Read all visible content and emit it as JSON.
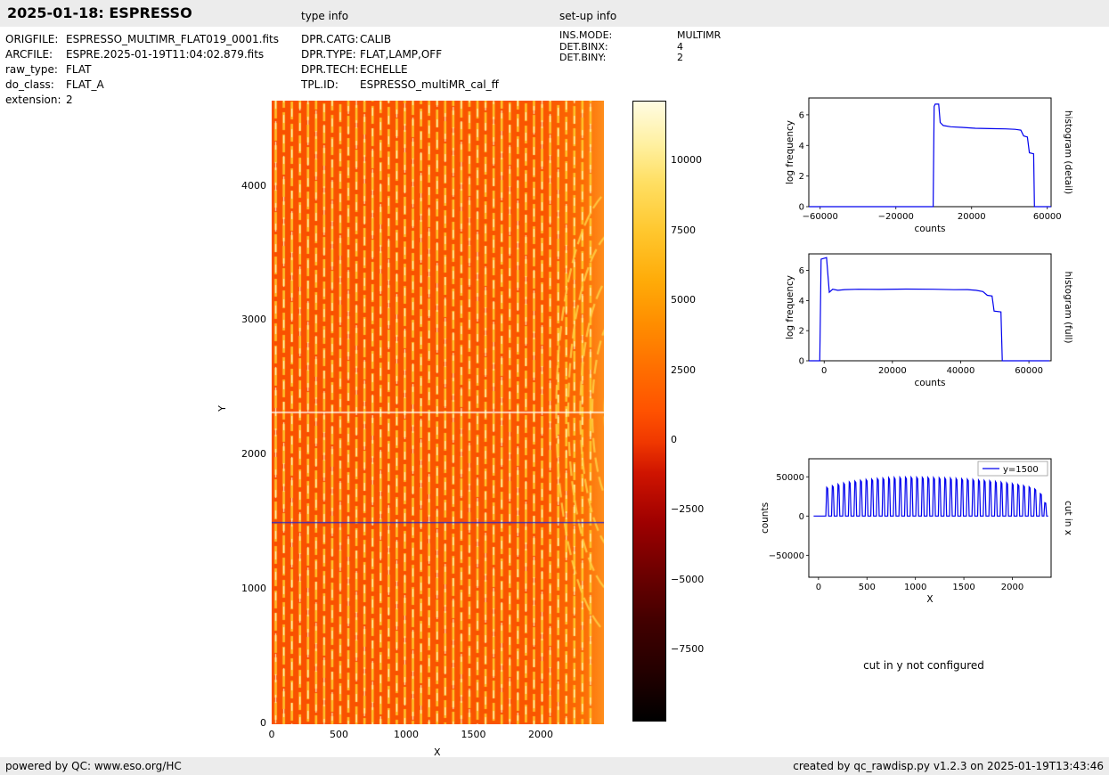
{
  "header": {
    "title": "2025-01-18: ESPRESSO",
    "type_info_label": "type info",
    "setup_info_label": "set-up info"
  },
  "metadata": {
    "file_info": [
      {
        "label": "ORIGFILE:",
        "value": "ESPRESSO_MULTIMR_FLAT019_0001.fits"
      },
      {
        "label": "ARCFILE:",
        "value": "ESPRE.2025-01-19T11:04:02.879.fits"
      },
      {
        "label": "raw_type:",
        "value": "FLAT"
      },
      {
        "label": "do_class:",
        "value": "FLAT_A"
      },
      {
        "label": "extension:",
        "value": "2"
      }
    ],
    "type_info": [
      {
        "label": "DPR.CATG:",
        "value": "CALIB"
      },
      {
        "label": "DPR.TYPE:",
        "value": "FLAT,LAMP,OFF"
      },
      {
        "label": "DPR.TECH:",
        "value": "ECHELLE"
      },
      {
        "label": "TPL.ID:",
        "value": "ESPRESSO_multiMR_cal_ff"
      }
    ],
    "setup_info": [
      {
        "label": "INS.MODE:",
        "value": "MULTIMR"
      },
      {
        "label": "DET.BINX:",
        "value": "4"
      },
      {
        "label": "DET.BINY:",
        "value": "2"
      }
    ]
  },
  "cut_y_note": "cut in y not configured",
  "footer": {
    "left": "powered by QC: www.eso.org/HC",
    "right": "created by qc_rawdisp.py v1.2.3 on 2025-01-19T13:43:46"
  },
  "colors": {
    "series": "#0000ee",
    "image_background": "#fa5500",
    "order_stripe": "#ffc82d",
    "order_core": "#fff8cd",
    "accent_blue": "#2a2acc"
  },
  "chart_data": [
    {
      "id": "raw_image",
      "type": "heatmap",
      "xlabel": "X",
      "ylabel": "Y",
      "xlim": [
        0,
        2470
      ],
      "ylim": [
        0,
        4640
      ],
      "xticks": [
        0,
        500,
        1000,
        1500,
        2000
      ],
      "yticks": [
        0,
        1000,
        2000,
        3000,
        4000
      ],
      "description": "ESPRESSO multiMR raw flat-field frame: ~40 bright vertical echelle-order stripes on an orange background, orders curving into arcs at the right edge; horizontal bright gap line near y=2320; blue cut line at y=1500",
      "n_orders": 40,
      "order_start_x": 30,
      "order_spacing_x": 60,
      "gap_line_y": 2320,
      "cut_line": {
        "y": 1500,
        "color": "#2a2acc"
      },
      "colorbar": {
        "ticks": [
          10000,
          7500,
          5000,
          2500,
          0,
          -2500,
          -5000,
          -7500
        ],
        "vmin": -9980,
        "vmax": 12180,
        "colormap": "black-red-orange-yellow-white (hot-like)"
      }
    },
    {
      "id": "histogram_detail",
      "type": "line",
      "right_label": "histogram (detail)",
      "xlabel": "counts",
      "ylabel": "log frequency",
      "xlim": [
        -66000,
        62000
      ],
      "ylim": [
        0,
        7.1
      ],
      "xticks": [
        -60000,
        -20000,
        20000,
        60000
      ],
      "yticks": [
        0,
        2,
        4,
        6
      ],
      "points": [
        [
          -66000,
          0
        ],
        [
          -300,
          0
        ],
        [
          200,
          6.55
        ],
        [
          800,
          6.7
        ],
        [
          2600,
          6.7
        ],
        [
          3400,
          5.5
        ],
        [
          5000,
          5.3
        ],
        [
          9000,
          5.22
        ],
        [
          15000,
          5.18
        ],
        [
          22000,
          5.12
        ],
        [
          30000,
          5.1
        ],
        [
          38000,
          5.08
        ],
        [
          43000,
          5.05
        ],
        [
          46000,
          5.0
        ],
        [
          47500,
          4.62
        ],
        [
          49500,
          4.55
        ],
        [
          50500,
          3.52
        ],
        [
          52800,
          3.45
        ],
        [
          53200,
          0
        ],
        [
          62000,
          0
        ]
      ]
    },
    {
      "id": "histogram_full",
      "type": "line",
      "right_label": "histogram (full)",
      "xlabel": "counts",
      "ylabel": "log frequency",
      "xlim": [
        -4500,
        66500
      ],
      "ylim": [
        0,
        7.1
      ],
      "xticks": [
        0,
        20000,
        40000,
        60000
      ],
      "yticks": [
        0,
        2,
        4,
        6
      ],
      "points": [
        [
          -4500,
          0
        ],
        [
          -1300,
          0
        ],
        [
          -900,
          6.75
        ],
        [
          700,
          6.85
        ],
        [
          1500,
          4.55
        ],
        [
          2500,
          4.75
        ],
        [
          4000,
          4.68
        ],
        [
          6000,
          4.73
        ],
        [
          10000,
          4.75
        ],
        [
          16000,
          4.74
        ],
        [
          24000,
          4.76
        ],
        [
          32000,
          4.75
        ],
        [
          38000,
          4.72
        ],
        [
          42000,
          4.73
        ],
        [
          44500,
          4.68
        ],
        [
          46500,
          4.6
        ],
        [
          47800,
          4.35
        ],
        [
          49200,
          4.3
        ],
        [
          49800,
          3.3
        ],
        [
          51800,
          3.25
        ],
        [
          52200,
          0
        ],
        [
          66000,
          0
        ]
      ]
    },
    {
      "id": "cut_in_x",
      "type": "line",
      "right_label": "cut in x",
      "legend": "y=1500",
      "xlabel": "X",
      "ylabel": "counts",
      "xlim": [
        -100,
        2400
      ],
      "ylim": [
        -78000,
        73000
      ],
      "xticks": [
        0,
        500,
        1000,
        1500,
        2000
      ],
      "yticks": [
        -50000,
        0,
        50000
      ],
      "spike_half_width": 14,
      "spikes": [
        [
          90,
          36500
        ],
        [
          148,
          38500
        ],
        [
          206,
          40500
        ],
        [
          264,
          42000
        ],
        [
          322,
          43500
        ],
        [
          380,
          44500
        ],
        [
          438,
          45500
        ],
        [
          496,
          46500
        ],
        [
          554,
          47000
        ],
        [
          612,
          47800
        ],
        [
          670,
          48300
        ],
        [
          728,
          48800
        ],
        [
          786,
          49000
        ],
        [
          844,
          49300
        ],
        [
          902,
          49500
        ],
        [
          960,
          49500
        ],
        [
          1018,
          49400
        ],
        [
          1076,
          49300
        ],
        [
          1134,
          49200
        ],
        [
          1192,
          49000
        ],
        [
          1250,
          48800
        ],
        [
          1308,
          48500
        ],
        [
          1366,
          48200
        ],
        [
          1424,
          47900
        ],
        [
          1482,
          47500
        ],
        [
          1540,
          47000
        ],
        [
          1598,
          46500
        ],
        [
          1656,
          46000
        ],
        [
          1714,
          45400
        ],
        [
          1772,
          44800
        ],
        [
          1830,
          44000
        ],
        [
          1888,
          43200
        ],
        [
          1946,
          42300
        ],
        [
          2004,
          41300
        ],
        [
          2062,
          40200
        ],
        [
          2120,
          38800
        ],
        [
          2178,
          37200
        ],
        [
          2236,
          34500
        ],
        [
          2294,
          28500
        ],
        [
          2340,
          17000
        ]
      ]
    }
  ]
}
